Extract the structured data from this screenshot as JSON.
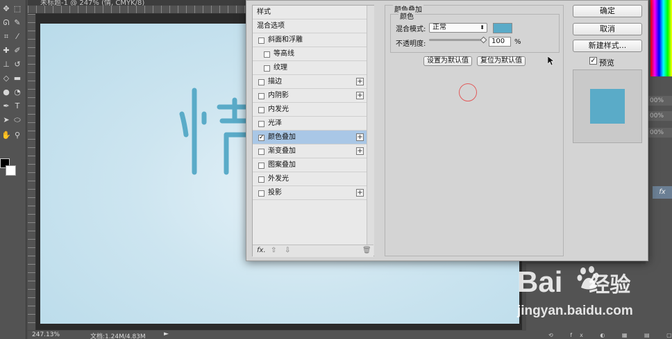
{
  "workspace": {
    "tab_title": "未标题-1 @ 247% (情, CMYK/8)",
    "status": {
      "zoom": "247.13%",
      "doc_size": "文档:1.24M/4.83M",
      "arrow": "►"
    },
    "panel_rows": [
      "00%",
      "00%",
      "00%"
    ],
    "layer_fx": "fx",
    "panel_icons": "⟲ fx ◐ ▦ ▤ ▢ 🗑",
    "canvas_colors": {
      "doc_gradient": [
        "#e6f2f8",
        "#b9dbea"
      ],
      "glyph": "#5aabc8"
    }
  },
  "tools": {
    "icons": [
      "move-tool-icon",
      "marquee-tool-icon",
      "lasso-tool-icon",
      "quick-select-icon",
      "crop-tool-icon",
      "eyedropper-icon",
      "healing-brush-icon",
      "brush-tool-icon",
      "clone-stamp-icon",
      "history-brush-icon",
      "eraser-icon",
      "gradient-tool-icon",
      "blur-tool-icon",
      "dodge-tool-icon",
      "pen-tool-icon",
      "type-tool-icon",
      "path-select-icon",
      "shape-tool-icon",
      "hand-tool-icon",
      "zoom-tool-icon"
    ]
  },
  "dialog": {
    "styles_list": [
      {
        "label": "样式",
        "type": "header"
      },
      {
        "label": "混合选项",
        "type": "header"
      },
      {
        "label": "斜面和浮雕",
        "checked": false,
        "plus": false,
        "indent": 0
      },
      {
        "label": "等高线",
        "checked": false,
        "plus": false,
        "indent": 1
      },
      {
        "label": "纹理",
        "checked": false,
        "plus": false,
        "indent": 1
      },
      {
        "label": "描边",
        "checked": false,
        "plus": true,
        "indent": 0
      },
      {
        "label": "内阴影",
        "checked": false,
        "plus": true,
        "indent": 0
      },
      {
        "label": "内发光",
        "checked": false,
        "plus": false,
        "indent": 0
      },
      {
        "label": "光泽",
        "checked": false,
        "plus": false,
        "indent": 0
      },
      {
        "label": "颜色叠加",
        "checked": true,
        "plus": true,
        "indent": 0,
        "selected": true
      },
      {
        "label": "渐变叠加",
        "checked": false,
        "plus": true,
        "indent": 0
      },
      {
        "label": "图案叠加",
        "checked": false,
        "plus": false,
        "indent": 0
      },
      {
        "label": "外发光",
        "checked": false,
        "plus": false,
        "indent": 0
      },
      {
        "label": "投影",
        "checked": false,
        "plus": true,
        "indent": 0
      }
    ],
    "list_footer": {
      "fx": "fx.",
      "up": "⇧",
      "down": "⇩",
      "trash": "🗑"
    },
    "overlay": {
      "section_title": "颜色叠加",
      "group_title": "颜色",
      "blend_label": "混合模式:",
      "blend_value": "正常",
      "blend_arrow": "⬍",
      "swatch_color": "#5aabc8",
      "opacity_label": "不透明度:",
      "opacity_value": "100",
      "opacity_fraction": 1.0,
      "opacity_unit": "%",
      "make_default": "设置为默认值",
      "reset_default": "复位为默认值"
    },
    "buttons": {
      "ok": "确定",
      "cancel": "取消",
      "new_style": "新建样式...",
      "preview_label": "预览",
      "preview_checked": true,
      "check_mark": "✓"
    }
  },
  "watermark": {
    "logo_text": "Bai",
    "logo_tail": "经验",
    "url": "jingyan.baidu.com"
  }
}
